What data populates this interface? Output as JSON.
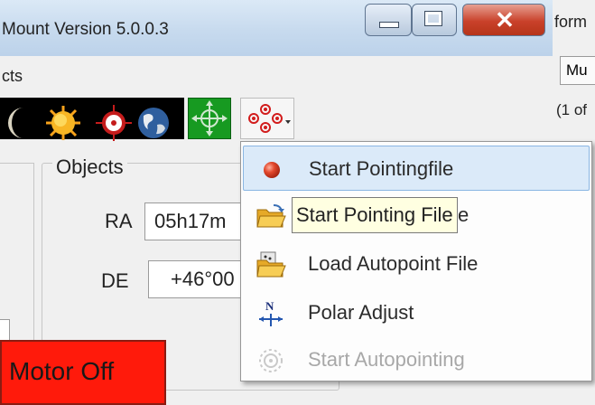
{
  "window": {
    "title": "Mount Version 5.0.0.3",
    "menu_text": "cts",
    "close_glyph": "✕"
  },
  "toolbar": {
    "icons": [
      "moon-icon",
      "sun-icon",
      "crosshair-icon",
      "earth-icon",
      "move-arrows-icon",
      "pointing-icon"
    ]
  },
  "objects": {
    "group_title": "Objects",
    "ra_label": "RA",
    "ra_value": "05h17m",
    "de_label": "DE",
    "de_value": "+46°00"
  },
  "motor_button": {
    "label": "Motor Off",
    "color": "#ff1a0b"
  },
  "background_window": {
    "title_fragment": "form",
    "tab_fragment": "Mu",
    "text_fragment": "(1 of"
  },
  "dropdown": {
    "items": [
      {
        "label": "Start Pointingfile",
        "icon": "red-ball-icon",
        "highlighted": true,
        "enabled": true
      },
      {
        "label": "e",
        "icon": "open-folder-icon",
        "highlighted": false,
        "enabled": true
      },
      {
        "label": "Load Autopoint File",
        "icon": "load-folder-icon",
        "highlighted": false,
        "enabled": true
      },
      {
        "label": "Polar Adjust",
        "icon": "polar-north-icon",
        "highlighted": false,
        "enabled": true
      },
      {
        "label": "Start Autopointing",
        "icon": "autopoint-gear-icon",
        "highlighted": false,
        "enabled": false
      }
    ],
    "tooltip": "Start Pointing File"
  }
}
